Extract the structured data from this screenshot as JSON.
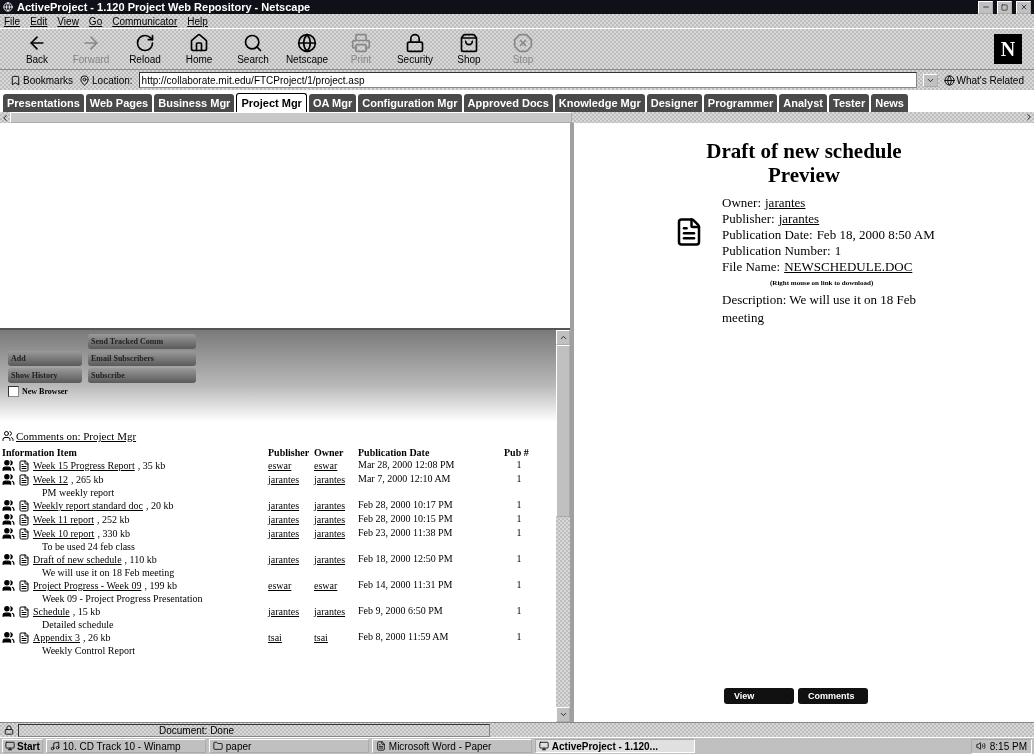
{
  "window": {
    "title": "ActiveProject - 1.120 Project Web Repository - Netscape"
  },
  "menu": [
    "File",
    "Edit",
    "View",
    "Go",
    "Communicator",
    "Help"
  ],
  "toolbar": [
    {
      "label": "Back",
      "disabled": false
    },
    {
      "label": "Forward",
      "disabled": true
    },
    {
      "label": "Reload",
      "disabled": false
    },
    {
      "label": "Home",
      "disabled": false
    },
    {
      "label": "Search",
      "disabled": false
    },
    {
      "label": "Netscape",
      "disabled": false
    },
    {
      "label": "Print",
      "disabled": true
    },
    {
      "label": "Security",
      "disabled": false
    },
    {
      "label": "Shop",
      "disabled": false
    },
    {
      "label": "Stop",
      "disabled": true
    }
  ],
  "logo": "N",
  "location_bar": {
    "bookmarks": "Bookmarks",
    "label": "Location:",
    "url": "http://collaborate.mit.edu/FTCProject/1/project.asp",
    "related": "What's Related"
  },
  "tabs": [
    {
      "label": "Presentations",
      "selected": false
    },
    {
      "label": "Web Pages",
      "selected": false
    },
    {
      "label": "Business Mgr",
      "selected": false
    },
    {
      "label": "Project Mgr",
      "selected": true
    },
    {
      "label": "OA Mgr",
      "selected": false
    },
    {
      "label": "Configuration Mgr",
      "selected": false
    },
    {
      "label": "Approved Docs",
      "selected": false
    },
    {
      "label": "Knowledge Mgr",
      "selected": false
    },
    {
      "label": "Designer",
      "selected": false
    },
    {
      "label": "Programmer",
      "selected": false
    },
    {
      "label": "Analyst",
      "selected": false
    },
    {
      "label": "Tester",
      "selected": false
    },
    {
      "label": "News",
      "selected": false
    }
  ],
  "actions": {
    "left": [
      "Add",
      "Show History"
    ],
    "right": [
      "Send Tracked Comm",
      "Email Subscribers",
      "Subscribe"
    ],
    "new_browser": {
      "label": "New Browser",
      "checked": false
    }
  },
  "comments_link": "Comments on: Project Mgr",
  "table": {
    "columns": [
      "Information Item",
      "Publisher",
      "Owner",
      "Publication Date",
      "Pub #"
    ],
    "rows": [
      {
        "name": "Week 15 Progress Report",
        "size": ", 35 kb",
        "publisher": "eswar",
        "owner": "eswar",
        "date": "Mar 28, 2000 12:08 PM",
        "pub": "1"
      },
      {
        "name": "Week 12",
        "size": ", 265 kb",
        "publisher": "jarantes",
        "owner": "jarantes",
        "date": "Mar 7, 2000 12:10 AM",
        "pub": "1",
        "description": "PM weekly report"
      },
      {
        "name": "Weekly report standard doc",
        "size": ", 20 kb",
        "publisher": "jarantes",
        "owner": "jarantes",
        "date": "Feb 28, 2000 10:17 PM",
        "pub": "1"
      },
      {
        "name": "Week 11 report",
        "size": ", 252 kb",
        "publisher": "jarantes",
        "owner": "jarantes",
        "date": "Feb 28, 2000 10:15 PM",
        "pub": "1"
      },
      {
        "name": "Week 10 report",
        "size": ", 330 kb",
        "publisher": "jarantes",
        "owner": "jarantes",
        "date": "Feb 23, 2000 11:38 PM",
        "pub": "1",
        "description": "To be used 24 feb class"
      },
      {
        "name": "Draft of new schedule",
        "size": ", 110 kb",
        "publisher": "jarantes",
        "owner": "jarantes",
        "date": "Feb 18, 2000 12:50 PM",
        "pub": "1",
        "description": "We will use it on 18 Feb meeting"
      },
      {
        "name": "Project Progress - Week 09",
        "size": ", 199 kb",
        "publisher": "eswar",
        "owner": "eswar",
        "date": "Feb 14, 2000 11:31 PM",
        "pub": "1",
        "description": "Week 09 - Project Progress Presentation"
      },
      {
        "name": "Schedule",
        "size": ", 15 kb",
        "publisher": "jarantes",
        "owner": "jarantes",
        "date": "Feb 9, 2000 6:50 PM",
        "pub": "1",
        "description": "Detailed schedule"
      },
      {
        "name": "Appendix 3",
        "size": ", 26 kb",
        "publisher": "tsai",
        "owner": "tsai",
        "date": "Feb 8, 2000 11:59 AM",
        "pub": "1",
        "description": "Weekly Control Report"
      }
    ]
  },
  "preview": {
    "title": "Draft of new schedule",
    "subtitle": "Preview",
    "fields": [
      {
        "label": "Owner:",
        "value": "jarantes",
        "kind": "link"
      },
      {
        "label": "Publisher:",
        "value": "jarantes",
        "kind": "link"
      },
      {
        "label": "Publication Date:",
        "value": "Feb 18, 2000 8:50 AM",
        "kind": "text"
      },
      {
        "label": "Publication Number:",
        "value": "1",
        "kind": "text"
      },
      {
        "label": "File Name:",
        "value": "NEWSCHEDULE.DOC",
        "kind": "link"
      }
    ],
    "file_hint": "(Right mouse on link to download)",
    "description": "Description: We will use it on 18 Feb meeting",
    "buttons": [
      "View",
      "Comments"
    ]
  },
  "status_bar": "Document: Done",
  "taskbar": {
    "start": "Start",
    "tasks": [
      {
        "label": "10. CD Track 10 - Winamp",
        "selected": false
      },
      {
        "label": "paper",
        "selected": false
      },
      {
        "label": "Microsoft Word - Paper",
        "selected": false
      },
      {
        "label": "ActiveProject - 1.120...",
        "selected": true
      }
    ],
    "clock": "8:15 PM"
  }
}
